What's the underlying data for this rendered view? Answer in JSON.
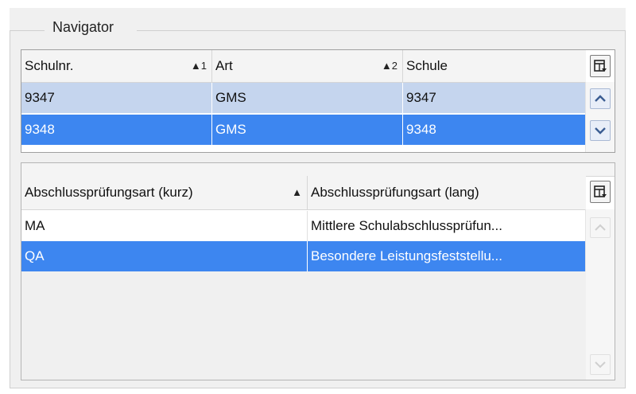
{
  "navigator": {
    "title": "Navigator"
  },
  "schools_grid": {
    "columns": [
      {
        "label": "Schulnr.",
        "sort": "▲1"
      },
      {
        "label": "Art",
        "sort": "▲2"
      },
      {
        "label": "Schule",
        "sort": ""
      }
    ],
    "rows": [
      {
        "schulnr": "9347",
        "art": "GMS",
        "schule": "9347",
        "state": "highlighted"
      },
      {
        "schulnr": "9348",
        "art": "GMS",
        "schule": "9348",
        "state": "selected"
      }
    ]
  },
  "exam_grid": {
    "columns": [
      {
        "label": "Abschlussprüfungsart (kurz)",
        "sort": "▲"
      },
      {
        "label": "Abschlussprüfungsart (lang)",
        "sort": ""
      }
    ],
    "rows": [
      {
        "kurz": "MA",
        "lang": "Mittlere Schulabschlussprüfun...",
        "state": "normal"
      },
      {
        "kurz": "QA",
        "lang": "Besondere Leistungsfeststellu...",
        "state": "selected"
      }
    ]
  },
  "colors": {
    "selected_row": "#3d86f0",
    "highlighted_row": "#c5d5ee",
    "panel_background": "#f0f0f0"
  },
  "icons": {
    "column_chooser": "column-chooser-icon",
    "scroll_up": "arrow-up-icon",
    "scroll_down": "arrow-down-icon"
  }
}
